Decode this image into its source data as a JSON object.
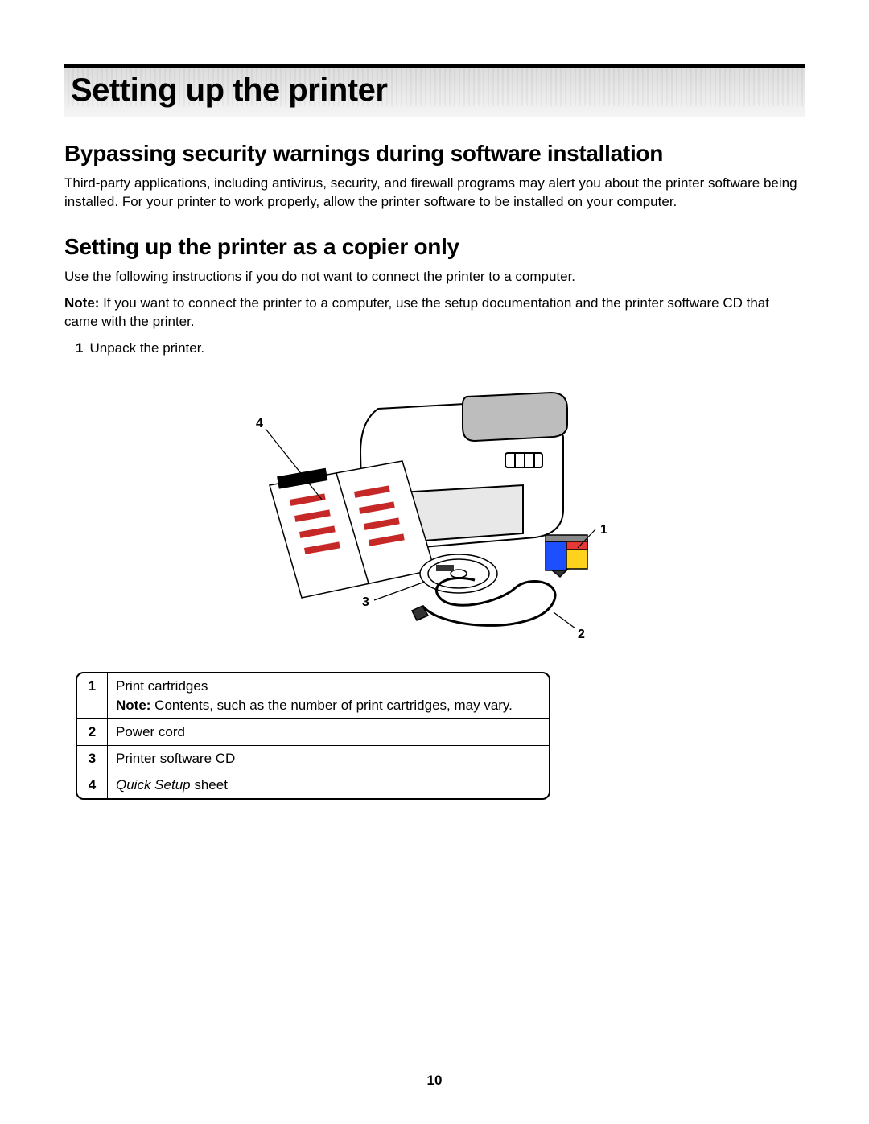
{
  "chapter_title": "Setting up the printer",
  "section1": {
    "heading": "Bypassing security warnings during software installation",
    "body": "Third-party applications, including antivirus, security, and firewall programs may alert you about the printer software being installed. For your printer to work properly, allow the printer software to be installed on your computer."
  },
  "section2": {
    "heading": "Setting up the printer as a copier only",
    "intro": "Use the following instructions if you do not want to connect the printer to a computer.",
    "note_label": "Note:",
    "note_text": " If you want to connect the printer to a computer, use the setup documentation and the printer software CD that came with the printer.",
    "step1_num": "1",
    "step1_text": "Unpack the printer."
  },
  "figure": {
    "callouts": {
      "c1": "1",
      "c2": "2",
      "c3": "3",
      "c4": "4"
    }
  },
  "parts": [
    {
      "num": "1",
      "desc": "Print cartridges",
      "note_label": "Note:",
      "note_text": " Contents, such as the number of print cartridges, may vary."
    },
    {
      "num": "2",
      "desc": "Power cord"
    },
    {
      "num": "3",
      "desc": "Printer software CD"
    },
    {
      "num": "4",
      "desc_italic": "Quick Setup",
      "desc_rest": " sheet"
    }
  ],
  "page_number": "10"
}
